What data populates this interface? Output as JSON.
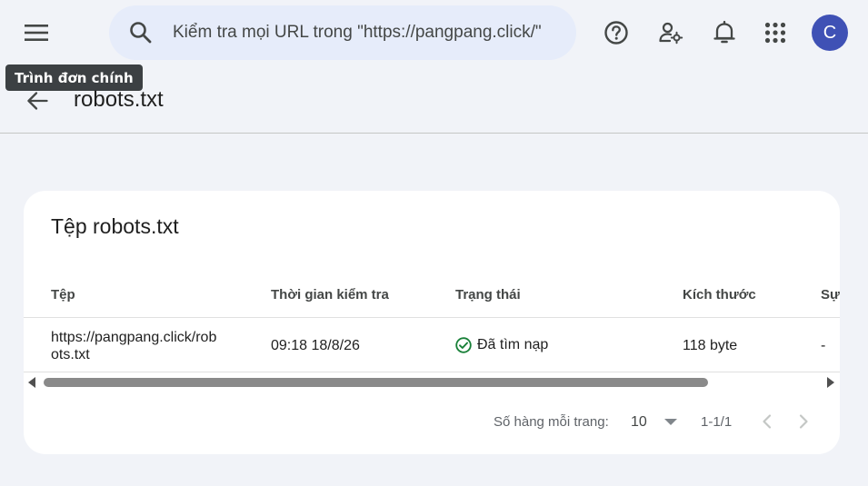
{
  "header": {
    "search_placeholder": "Kiểm tra mọi URL trong \"https://pangpang.click/\"",
    "avatar_letter": "C",
    "avatar_color": "#3f51b5"
  },
  "tooltip": "Trình đơn chính",
  "page": {
    "title": "robots.txt"
  },
  "card": {
    "title": "Tệp robots.txt",
    "columns": [
      "Tệp",
      "Thời gian kiểm tra",
      "Trạng thái",
      "Kích thước",
      "Sự"
    ],
    "rows": [
      {
        "file_line1": "https://pangpang.click/rob",
        "file_line2": "ots.txt",
        "checked_time": "09:18 18/8/26",
        "status": "Đã tìm nạp",
        "size": "118 byte",
        "extra": "-"
      }
    ],
    "status_color": "#188038"
  },
  "pagination": {
    "rows_label": "Số hàng mỗi trang:",
    "rows_value": "10",
    "range": "1-1/1"
  },
  "icons": [
    "menu-icon",
    "search-icon",
    "help-icon",
    "manage-accounts-icon",
    "notifications-icon",
    "apps-icon",
    "arrow-back-icon",
    "check-circle-icon",
    "chevron-left-icon",
    "chevron-right-icon"
  ]
}
